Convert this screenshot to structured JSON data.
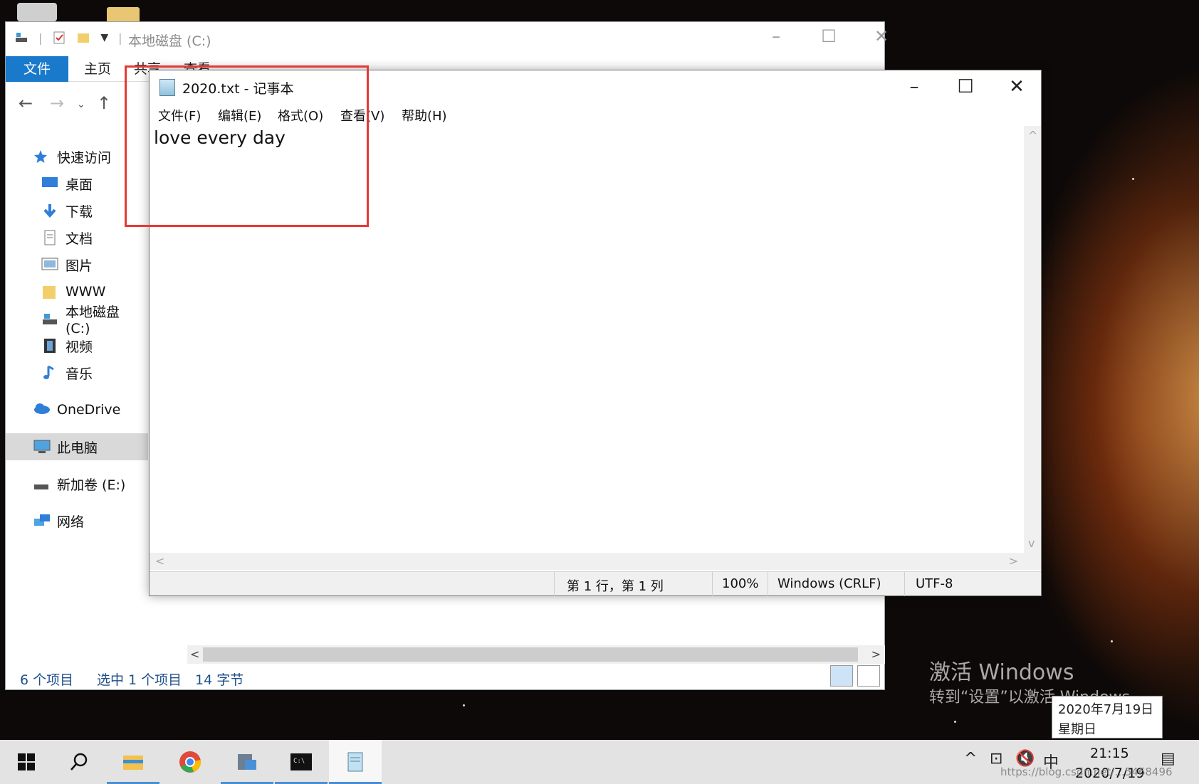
{
  "explorer": {
    "title": "本地磁盘 (C:)",
    "ribbon": {
      "file": "文件",
      "home": "主页",
      "share": "共享",
      "view": "查看"
    },
    "sidebar": [
      {
        "label": "快速访问",
        "icon": "star-icon"
      },
      {
        "label": "桌面",
        "icon": "desktop-icon"
      },
      {
        "label": "下载",
        "icon": "download-icon"
      },
      {
        "label": "文档",
        "icon": "document-icon"
      },
      {
        "label": "图片",
        "icon": "pictures-icon"
      },
      {
        "label": "WWW",
        "icon": "folder-icon"
      },
      {
        "label": "本地磁盘 (C:)",
        "icon": "drive-icon"
      },
      {
        "label": "视频",
        "icon": "video-icon"
      },
      {
        "label": "音乐",
        "icon": "music-icon"
      },
      {
        "label": "OneDrive",
        "icon": "cloud-icon"
      },
      {
        "label": "此电脑",
        "icon": "computer-icon"
      },
      {
        "label": "新加卷 (E:)",
        "icon": "drive-icon"
      },
      {
        "label": "网络",
        "icon": "network-icon"
      }
    ],
    "status": {
      "items": "6 个项目",
      "selected": "选中 1 个项目",
      "size": "14 字节"
    }
  },
  "notepad": {
    "title": "2020.txt - 记事本",
    "menu": [
      "文件(F)",
      "编辑(E)",
      "格式(O)",
      "查看(V)",
      "帮助(H)"
    ],
    "content": "love every day",
    "status": {
      "position": "第 1 行，第 1 列",
      "zoom": "100%",
      "line_ending": "Windows (CRLF)",
      "encoding": "UTF-8"
    }
  },
  "desktop": {
    "watermark_title": "激活 Windows",
    "watermark_sub": "转到“设置”以激活 Windows。"
  },
  "tooltip": {
    "date": "2020年7月19日",
    "weekday": "星期日"
  },
  "taskbar": {
    "ime": "中",
    "time": "21:15",
    "date": "2020/7/19",
    "blog_watermark": "https://blog.csdn.net/...5468496"
  },
  "colors": {
    "accent": "#1979ca",
    "highlight_box": "#e53935"
  }
}
